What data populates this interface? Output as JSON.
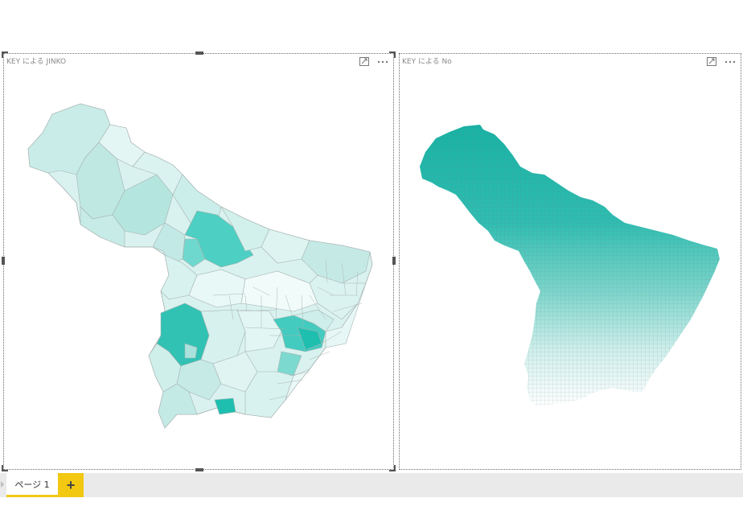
{
  "visuals": [
    {
      "title": "KEY による JINKO",
      "focus_icon": "focus-mode-icon",
      "more_icon": "more-options-icon"
    },
    {
      "title": "KEY による No",
      "focus_icon": "focus-mode-icon",
      "more_icon": "more-options-icon"
    }
  ],
  "colors": {
    "accent": "#f2c811",
    "map_dark": "#1fbfb0",
    "map_light": "#d9f2ef",
    "grid_dark": "#21b3a6",
    "grid_light": "#ffffff"
  },
  "page_tabs": {
    "tabs": [
      {
        "label": "ページ 1",
        "active": true
      }
    ],
    "add_label": "+"
  }
}
